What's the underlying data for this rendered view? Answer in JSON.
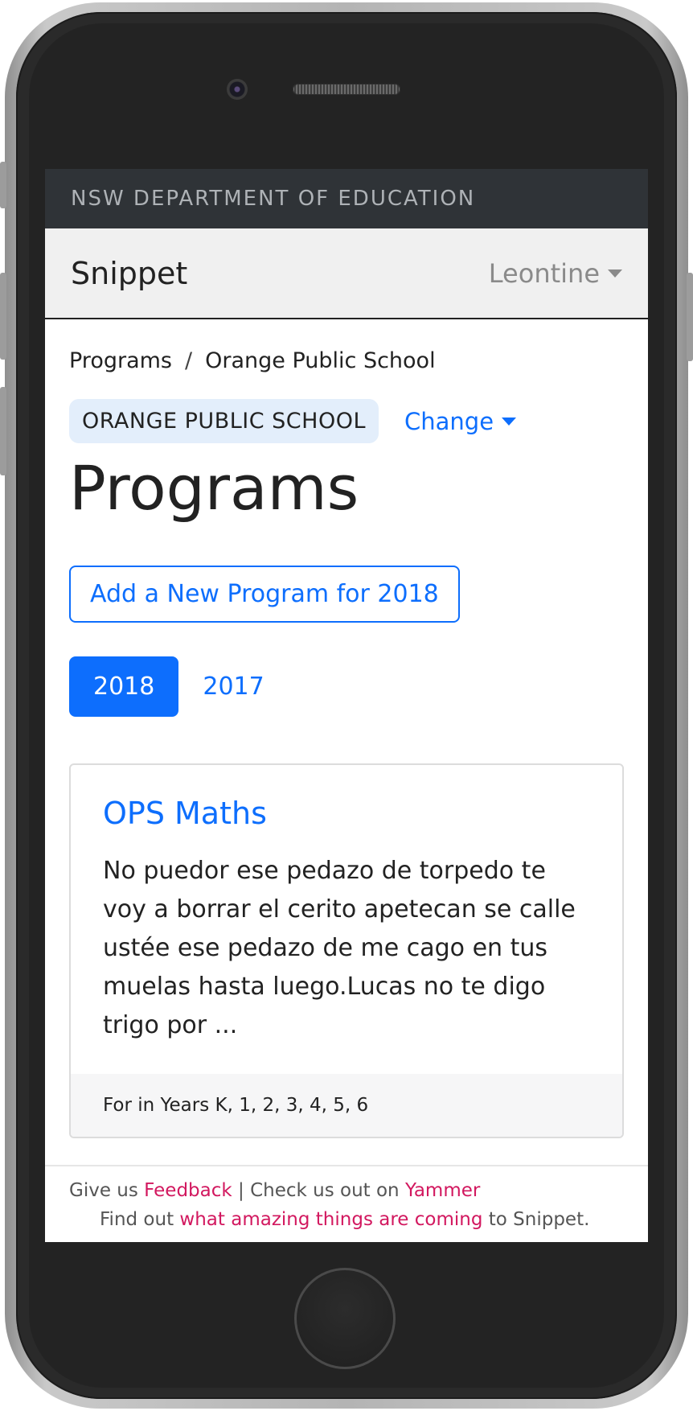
{
  "topbar": {
    "org_name": "NSW DEPARTMENT OF EDUCATION"
  },
  "navbar": {
    "brand": "Snippet",
    "user_name": "Leontine"
  },
  "breadcrumb": {
    "items": [
      "Programs",
      "Orange Public School"
    ],
    "separator": "/"
  },
  "school": {
    "badge": "ORANGE PUBLIC SCHOOL",
    "change_label": "Change"
  },
  "page": {
    "title": "Programs"
  },
  "actions": {
    "add_program_label": "Add a New Program for 2018"
  },
  "year_tabs": [
    {
      "label": "2018",
      "active": true
    },
    {
      "label": "2017",
      "active": false
    }
  ],
  "programs": [
    {
      "title": "OPS Maths",
      "description": "No puedor ese pedazo de torpedo te voy a borrar el cerito apetecan se calle ustée ese pedazo de me cago en tus muelas hasta luego.Lucas no te digo trigo por ...",
      "years": "For in Years K, 1, 2, 3, 4, 5, 6"
    }
  ],
  "footer": {
    "give_us": "Give us",
    "feedback_link": "Feedback",
    "check_us": "| Check us out on",
    "yammer_link": "Yammer",
    "find_out": "Find out",
    "coming_link": "what amazing things are coming",
    "to_snippet": "to Snippet."
  },
  "colors": {
    "primary": "#0d6efd",
    "topbar_bg": "#2f3337",
    "navbar_bg": "#f0f0f0",
    "footer_link": "#d2185f",
    "badge_bg": "#e3eefb"
  }
}
